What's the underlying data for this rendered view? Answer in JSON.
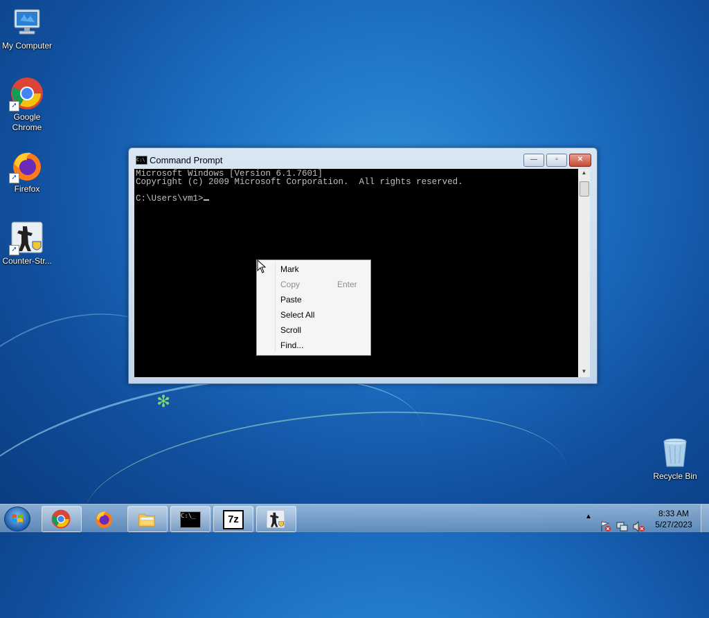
{
  "desktop": {
    "icons": [
      {
        "label": "My Computer",
        "icon": "computer-icon"
      },
      {
        "label": "Google Chrome",
        "icon": "chrome-icon"
      },
      {
        "label": "Firefox",
        "icon": "firefox-icon"
      },
      {
        "label": "Counter-Str...",
        "icon": "counter-strike-icon"
      },
      {
        "label": "Recycle Bin",
        "icon": "recycle-bin-icon"
      }
    ]
  },
  "window": {
    "title": "Command Prompt",
    "console_lines": [
      "Microsoft Windows [Version 6.1.7601]",
      "Copyright (c) 2009 Microsoft Corporation.  All rights reserved.",
      "",
      "C:\\Users\\vm1>"
    ],
    "minimize": "—",
    "maximize": "▫",
    "close": "✕"
  },
  "context_menu": {
    "items": [
      {
        "label": "Mark",
        "enabled": true
      },
      {
        "label": "Copy",
        "enabled": false,
        "shortcut": "Enter"
      },
      {
        "label": "Paste",
        "enabled": true
      },
      {
        "label": "Select All",
        "enabled": true
      },
      {
        "label": "Scroll",
        "enabled": true
      },
      {
        "label": "Find...",
        "enabled": true
      }
    ]
  },
  "taskbar": {
    "apps": [
      "chrome-icon",
      "firefox-icon",
      "explorer-icon",
      "cmd-icon",
      "7zip-icon",
      "counter-strike-icon"
    ],
    "cmd_glyph": "C:\\_",
    "zip_glyph": "7z",
    "tray_arrow": "▲",
    "time": "8:33 AM",
    "date": "5/27/2023"
  }
}
